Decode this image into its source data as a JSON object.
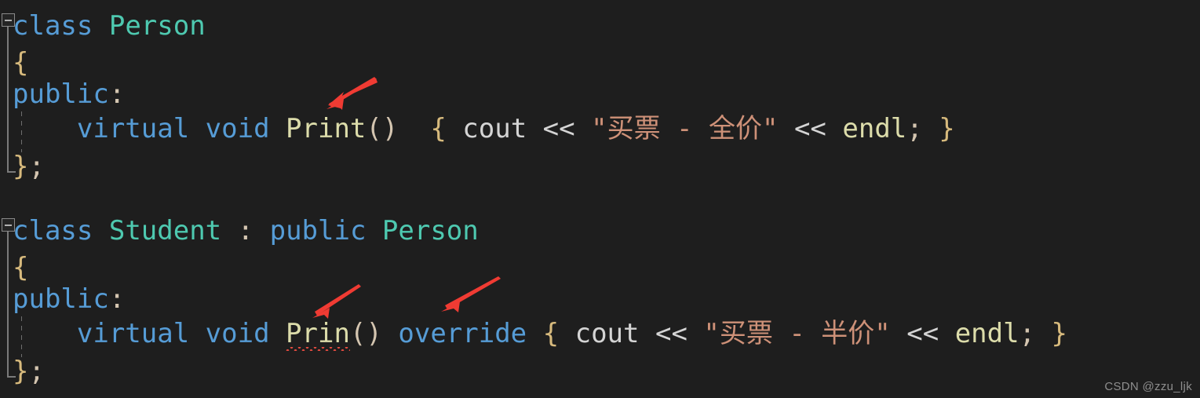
{
  "editor": {
    "background_color": "#1e1e1e",
    "language": "cpp",
    "theme": "dark-plus"
  },
  "colors": {
    "keyword": "#569cd6",
    "type": "#4ec9b0",
    "function": "#dcdcaa",
    "string": "#ce9178",
    "punctuation": "#d4c5b0",
    "plain_text": "#d4d4d4",
    "bracket_level1": "#d7ba7d",
    "error_squiggle": "#e04a3f",
    "annotation_arrow": "#f03b33",
    "watermark": "#8e8e8e"
  },
  "code": {
    "block_person": {
      "line1": {
        "keyword_class": "class",
        "type_name": "Person"
      },
      "line2": {
        "open_brace": "{"
      },
      "line3": {
        "keyword": "public",
        "colon": ":"
      },
      "line4": {
        "kw_virtual": "virtual",
        "kw_void": "void",
        "fn_name": "Print",
        "parens": "()",
        "open_brace": "{",
        "stream_obj": "cout",
        "op1": "<<",
        "string_literal": "\"买票 - 全价\"",
        "op2": "<<",
        "endl": "endl",
        "semicolon": ";",
        "close_brace": "}"
      },
      "line5": {
        "close_brace": "}",
        "semicolon": ";"
      }
    },
    "block_student": {
      "line1": {
        "keyword_class": "class",
        "type_name": "Student",
        "colon": ":",
        "keyword_public": "public",
        "base_type": "Person"
      },
      "line2": {
        "open_brace": "{"
      },
      "line3": {
        "keyword": "public",
        "colon": ":"
      },
      "line4": {
        "kw_virtual": "virtual",
        "kw_void": "void",
        "fn_name": "Prin",
        "parens": "()",
        "kw_override": "override",
        "open_brace": "{",
        "stream_obj": "cout",
        "op1": "<<",
        "string_literal": "\"买票 - 半价\"",
        "op2": "<<",
        "endl": "endl",
        "semicolon": ";",
        "close_brace": "}",
        "has_error_squiggle": true
      },
      "line5": {
        "close_brace": "}",
        "semicolon": ";"
      }
    }
  },
  "annotations": {
    "arrows": [
      {
        "name": "arrow-pointing-print",
        "target": "Print"
      },
      {
        "name": "arrow-pointing-prin",
        "target": "Prin"
      },
      {
        "name": "arrow-pointing-override",
        "target": "override"
      }
    ]
  },
  "watermark": {
    "text": "CSDN @zzu_ljk"
  }
}
